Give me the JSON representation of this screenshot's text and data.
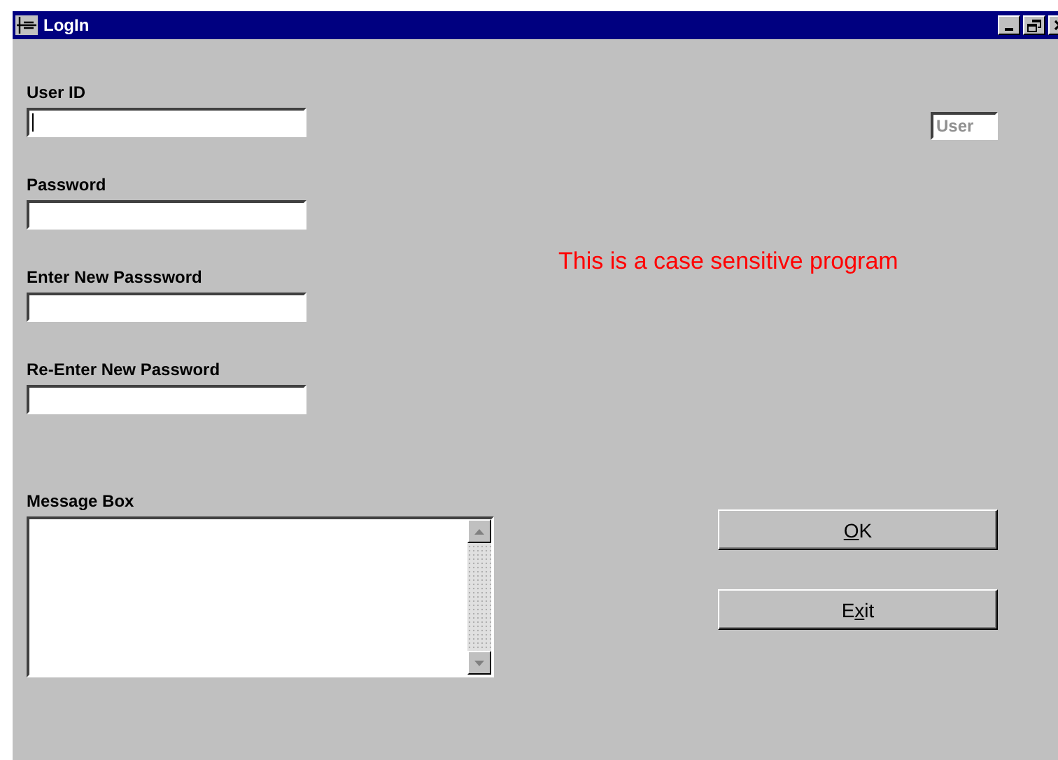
{
  "window": {
    "title": "LogIn"
  },
  "fields": [
    {
      "label": "User ID",
      "focused": true
    },
    {
      "label": "Password",
      "focused": false
    },
    {
      "label": "Enter New Passsword",
      "focused": false
    },
    {
      "label": "Re-Enter New Password",
      "focused": false
    }
  ],
  "message_box": {
    "label": "Message Box"
  },
  "user_field": {
    "value": "User",
    "disabled": true
  },
  "notice": "This is a case sensitive program",
  "buttons": [
    {
      "key": "O",
      "after": "K"
    },
    {
      "before": "E",
      "key": "x",
      "after": "it"
    }
  ]
}
